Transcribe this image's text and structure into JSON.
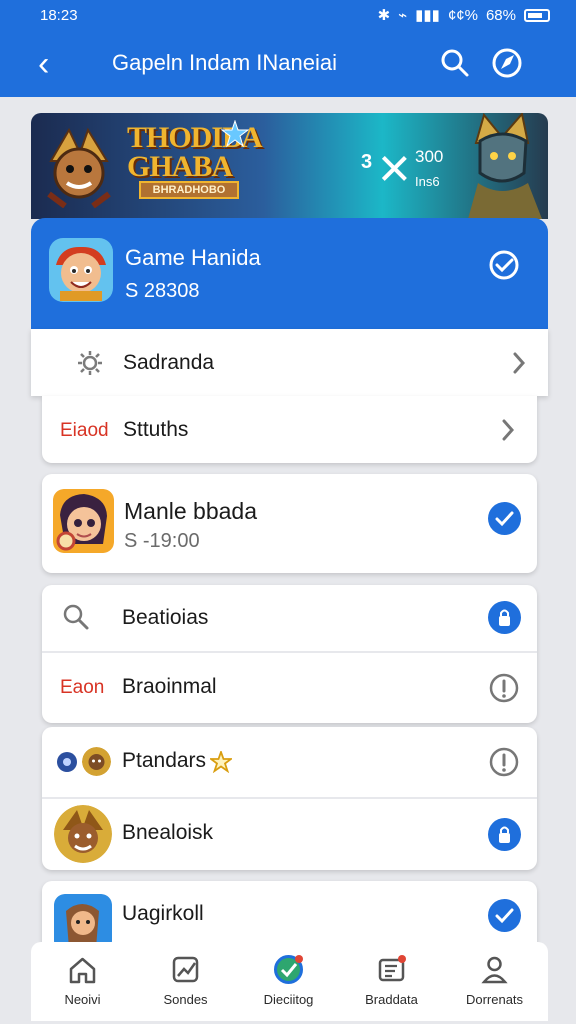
{
  "status_bar": {
    "time": "18:23",
    "signal": "¢¢%",
    "battery": "68%"
  },
  "header": {
    "title": "Gapeln Indam INaneiai"
  },
  "banner": {
    "title_line1": "THODIBA",
    "title_line2": "GHABA",
    "subtitle": "BHRADHOBO",
    "score_big": "3",
    "score_top": "300",
    "score_small": "Ins6"
  },
  "selected_game": {
    "name": "Game Hanida",
    "subtitle": "S 28308"
  },
  "settings": {
    "label": "Sadranda",
    "red_label": "Eiaod",
    "status_label": "Sttuths"
  },
  "games": [
    {
      "name": "Manle bbada",
      "subtitle": "S -19:00"
    }
  ],
  "actions": [
    {
      "label": "Beatioias"
    },
    {
      "red_label": "Eaon",
      "label": "Braoinmal"
    }
  ],
  "list": [
    {
      "label": "Ptandars"
    },
    {
      "label": "Bnealoisk"
    },
    {
      "label": "Uagirkoll"
    }
  ],
  "bottom_nav": [
    {
      "label": "Neoivi"
    },
    {
      "label": "Sondes"
    },
    {
      "label": "Dieciitog"
    },
    {
      "label": "Braddata"
    },
    {
      "label": "Dorrenats"
    }
  ],
  "colors": {
    "primary": "#1f6fdc",
    "red": "#d83425",
    "background": "#e7e8ec",
    "gray_icon": "#7b7b7b"
  },
  "icons": [
    "back-icon",
    "search-icon",
    "compass-icon",
    "gear-icon",
    "chevron-icon",
    "check-icon",
    "info-icon",
    "lock-icon",
    "home-icon",
    "chart-icon",
    "globe-icon",
    "document-icon",
    "profile-icon"
  ]
}
